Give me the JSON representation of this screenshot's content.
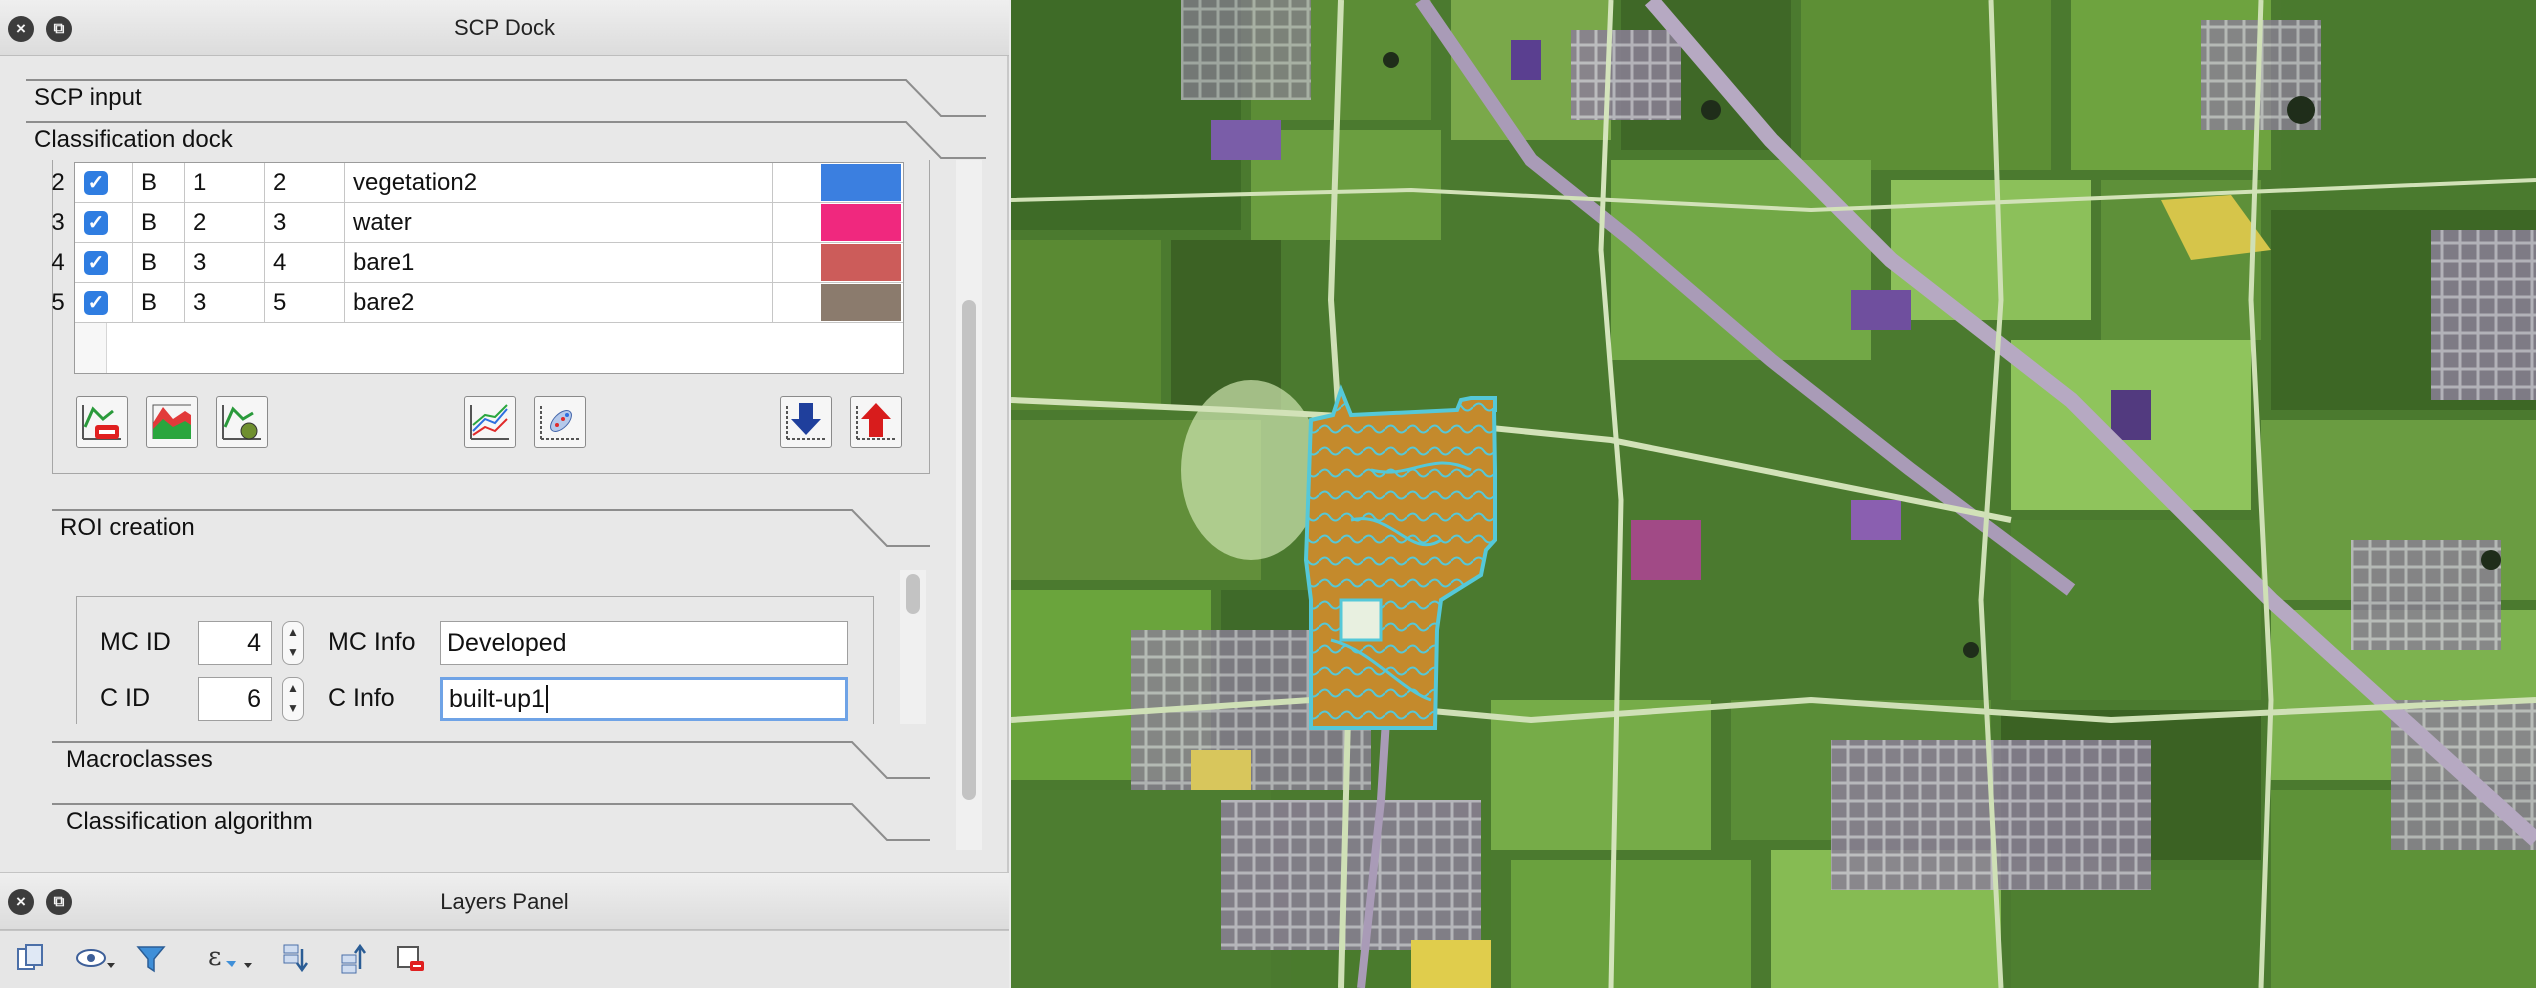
{
  "scp_dock": {
    "title": "SCP Dock",
    "sections": {
      "scp_input": "SCP input",
      "classification_dock": "Classification dock",
      "roi_creation": "ROI creation",
      "macroclasses": "Macroclasses",
      "classification_algorithm": "Classification algorithm"
    },
    "class_table": {
      "rows": [
        {
          "index": "2",
          "checked": true,
          "type": "B",
          "mc_id": "1",
          "c_id": "2",
          "info": "vegetation2",
          "color": "#3b7fe0"
        },
        {
          "index": "3",
          "checked": true,
          "type": "B",
          "mc_id": "2",
          "c_id": "3",
          "info": "water",
          "color": "#f0287e"
        },
        {
          "index": "4",
          "checked": true,
          "type": "B",
          "mc_id": "3",
          "c_id": "4",
          "info": "bare1",
          "color": "#cc5c5a"
        },
        {
          "index": "5",
          "checked": true,
          "type": "B",
          "mc_id": "3",
          "c_id": "5",
          "info": "bare2",
          "color": "#8b7b6d"
        }
      ],
      "check_glyph": "✓"
    },
    "toolbar_icons": [
      "remove-roi-icon",
      "merge-spectral-icon",
      "calculate-signature-icon",
      "spectral-plot-icon",
      "scatter-plot-icon",
      "import-icon",
      "export-icon"
    ],
    "roi": {
      "mc_id_label": "MC ID",
      "mc_id_value": "4",
      "mc_info_label": "MC Info",
      "mc_info_value": "Developed",
      "c_id_label": "C ID",
      "c_id_value": "6",
      "c_info_label": "C Info",
      "c_info_value": "built-up1"
    }
  },
  "layers_panel": {
    "title": "Layers Panel",
    "toolbar_icons": [
      "add-group-icon",
      "visibility-icon",
      "filter-icon",
      "expression-filter-icon",
      "expand-all-icon",
      "collapse-all-icon",
      "remove-layer-icon"
    ]
  },
  "window_buttons": {
    "close": "×",
    "float": "⧉"
  },
  "colors": {
    "roi_outline": "#55c8d8",
    "roi_fill": "#c8902f",
    "highlight_yellow": "#d6c54a",
    "focus_blue": "#6fa3e6"
  }
}
